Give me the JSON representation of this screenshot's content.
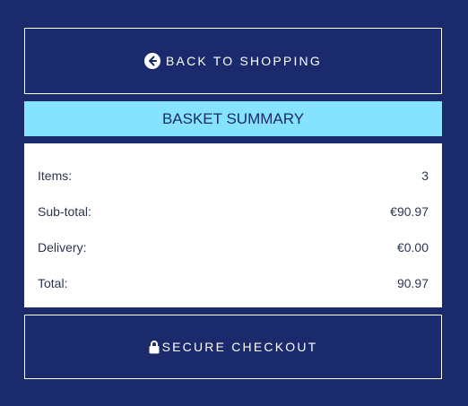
{
  "back_button": {
    "label": "BACK TO SHOPPING",
    "icon": "arrow-left-circle-icon"
  },
  "summary": {
    "title": "BASKET SUMMARY",
    "rows": [
      {
        "label": "Items:",
        "value": "3"
      },
      {
        "label": "Sub-total:",
        "value": "€90.97"
      },
      {
        "label": "Delivery:",
        "value": "€0.00"
      },
      {
        "label": "Total:",
        "value": "90.97"
      }
    ]
  },
  "checkout_button": {
    "label": "SECURE CHECKOUT",
    "icon": "lock-icon"
  },
  "colors": {
    "background": "#1a2a6c",
    "header_accent": "#86e3ff",
    "panel": "#ffffff",
    "text_dark": "#2b3550"
  }
}
